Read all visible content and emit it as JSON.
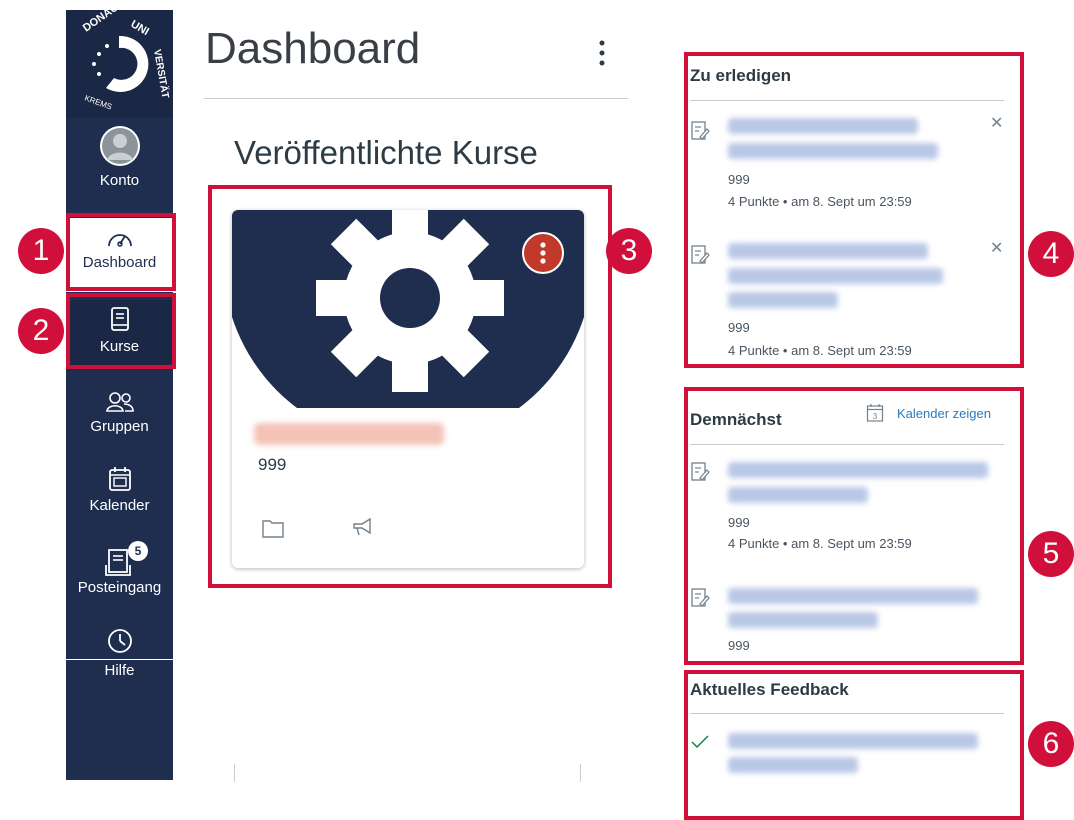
{
  "sidebar": {
    "items": [
      {
        "label": "Konto"
      },
      {
        "label": "Dashboard"
      },
      {
        "label": "Kurse"
      },
      {
        "label": "Gruppen"
      },
      {
        "label": "Kalender"
      },
      {
        "label": "Posteingang",
        "badge": "5"
      },
      {
        "label": "Hilfe"
      }
    ],
    "logo_text": "DONAU UNIVERSITÄT KREMS"
  },
  "markers": [
    "1",
    "2",
    "3",
    "4",
    "5",
    "6"
  ],
  "main": {
    "title": "Dashboard",
    "section_heading": "Veröffentlichte Kurse",
    "course_card": {
      "code": "999"
    }
  },
  "todo": {
    "title": "Zu erledigen",
    "items": [
      {
        "code": "999",
        "meta": "4 Punkte • am 8. Sept um 23:59"
      },
      {
        "code": "999",
        "meta": "4 Punkte • am 8. Sept um 23:59"
      }
    ]
  },
  "upcoming": {
    "title": "Demnächst",
    "calendar_link": "Kalender zeigen",
    "calendar_icon_day": "3",
    "items": [
      {
        "code": "999",
        "meta": "4 Punkte • am 8. Sept um 23:59"
      },
      {
        "code": "999"
      }
    ]
  },
  "feedback": {
    "title": "Aktuelles Feedback"
  },
  "colors": {
    "sidebar": "#1f2d4f",
    "highlight": "#d0103a",
    "link": "#2b7abc"
  }
}
